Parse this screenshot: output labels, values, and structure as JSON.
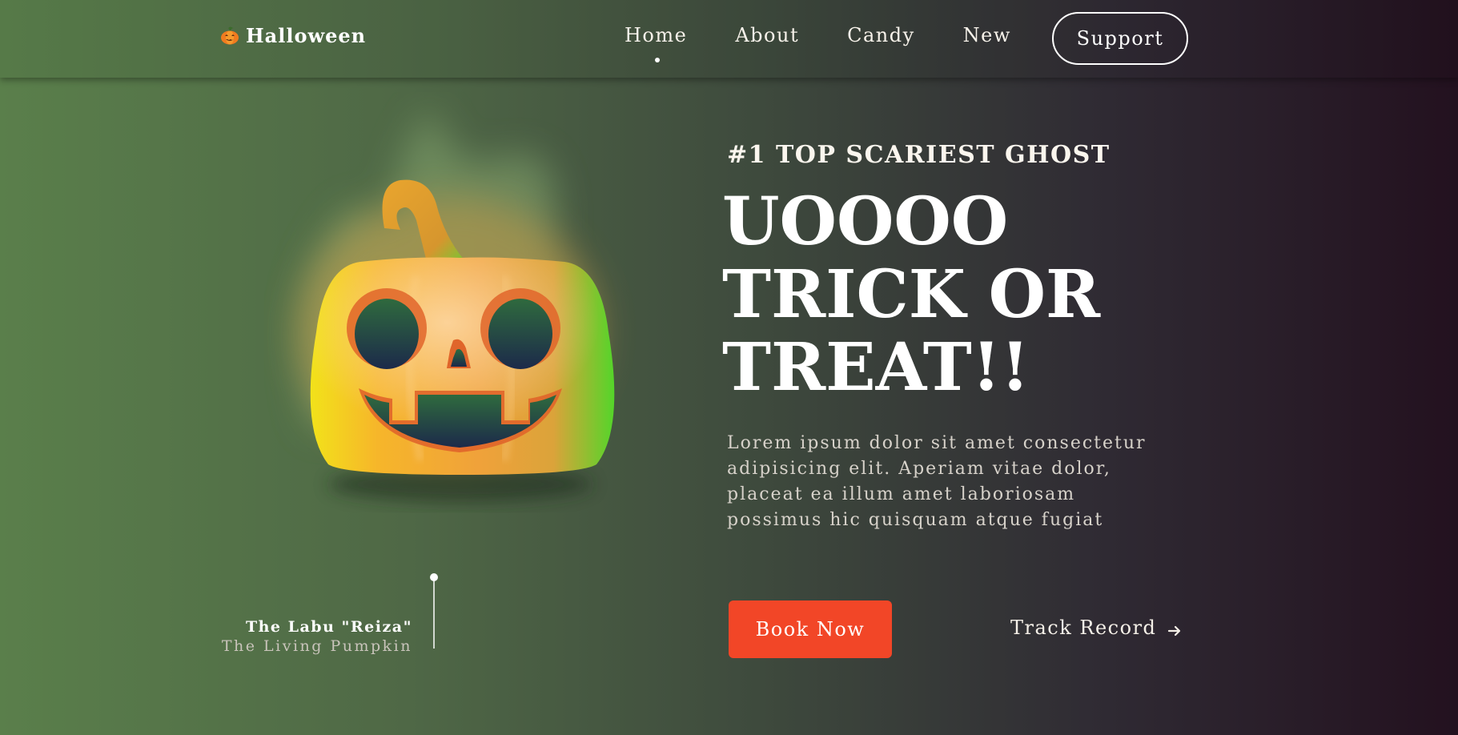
{
  "brand": {
    "name": "Halloween",
    "icon": "pumpkin-icon"
  },
  "nav": {
    "items": [
      {
        "label": "Home",
        "active": true
      },
      {
        "label": "About",
        "active": false
      },
      {
        "label": "Candy",
        "active": false
      },
      {
        "label": "New",
        "active": false
      }
    ],
    "support_label": "Support"
  },
  "hero": {
    "eyebrow": "#1 TOP SCARIEST GHOST",
    "headline_lines": [
      "UOOOO",
      "TRICK OR",
      "TREAT!!"
    ],
    "body": "Lorem ipsum dolor sit amet consectetur adipisicing elit. Aperiam vitae dolor, placeat ea illum amet laboriosam possimus hic quisquam atque fugiat",
    "primary_cta": "Book Now",
    "secondary_cta": "Track Record",
    "secondary_cta_icon": "arrow-right-icon"
  },
  "feature": {
    "name": "The Labu \"Reiza\"",
    "subtitle": "The Living Pumpkin",
    "image": "jack-o-lantern-illustration"
  },
  "colors": {
    "accent": "#f24627",
    "pumpkin_orange": "#f4a028",
    "pumpkin_green": "#4fcf2a",
    "background_left": "#5a7f4b",
    "background_right": "#23111f"
  }
}
